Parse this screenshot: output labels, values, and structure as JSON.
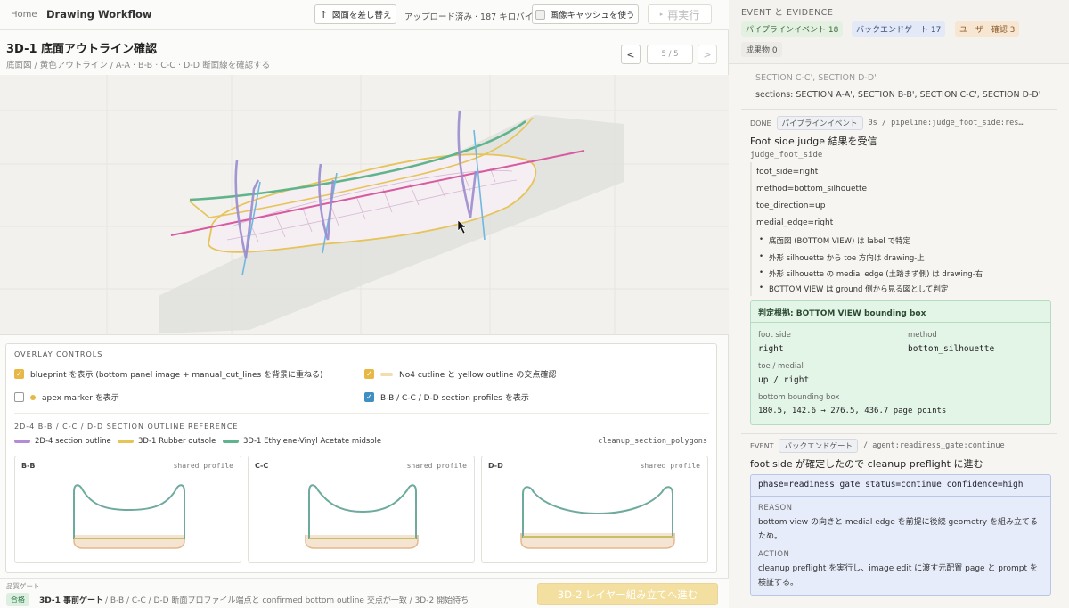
{
  "header": {
    "home": "Home",
    "title": "Drawing Workflow",
    "replace_btn": "図面を差し替え",
    "upload_status": "アップロード済み · 187 キロバイト",
    "cache_label": "画像キャッシュを使う",
    "rerun_btn": "再実行"
  },
  "step": {
    "title": "3D-1 底面アウトライン確認",
    "subtitle": "底面図 / 黄色アウトライン / A-A · B-B · C-C · D-D 断面線を確認する",
    "prev": "<",
    "next": ">",
    "page": "5 / 5"
  },
  "overlay": {
    "heading": "OVERLAY CONTROLS",
    "controls": [
      {
        "label": "blueprint を表示 (bottom panel image + manual_cut_lines を背景に重ねる)",
        "checked": true
      },
      {
        "label": "No4 cutline と yellow outline の交点確認",
        "checked": true
      },
      {
        "label": "apex marker を表示",
        "checked": false
      },
      {
        "label": "B-B / C-C / D-D section profiles を表示",
        "checked": true
      }
    ],
    "ref_heading": "2D-4 B-B / C-C / D-D SECTION OUTLINE REFERENCE",
    "legend": [
      {
        "label": "2D-4 section outline",
        "color": "#b58ad6"
      },
      {
        "label": "3D-1 Rubber outsole",
        "color": "#e6c458"
      },
      {
        "label": "3D-1 Ethylene-Vinyl Acetate midsole",
        "color": "#5fb48c"
      }
    ],
    "ref_source": "cleanup_section_polygons",
    "profiles": [
      {
        "name": "B-B",
        "note": "shared profile"
      },
      {
        "name": "C-C",
        "note": "shared profile"
      },
      {
        "name": "D-D",
        "note": "shared profile"
      }
    ]
  },
  "quality_gate": {
    "label": "品質ゲート",
    "badge": "合格",
    "title": "3D-1 事前ゲート",
    "detail": "/  B-B / C-C / D-D 断面プロファイル端点と confirmed bottom outline 交点が一致 / 3D-2 開始待ち",
    "advance_btn": "3D-2 レイヤー組み立てへ進む"
  },
  "evidence": {
    "heading": "EVENT と EVIDENCE",
    "chips": [
      {
        "label": "パイプラインイベント 18",
        "color": "#e4f1e2",
        "text": "#3f6a3b"
      },
      {
        "label": "バックエンドゲート 17",
        "color": "#e3e9f6",
        "text": "#3b4e7a"
      },
      {
        "label": "ユーザー確認 3",
        "color": "#f7e6d2",
        "text": "#8a5a2a"
      },
      {
        "label": "成果物 0",
        "color": "#ecebe7",
        "text": "#555"
      }
    ],
    "cut_line": "SECTION C-C', SECTION D-D'",
    "sections_line": "sections: SECTION A-A', SECTION B-B', SECTION C-C', SECTION D-D'",
    "ev1": {
      "status": "DONE",
      "chip": "パイプラインイベント",
      "meta": "0s  /  pipeline:judge_foot_side:res…",
      "title": "Foot side judge 結果を受信",
      "code": "judge_foot_side",
      "kv": [
        "foot_side=right",
        "method=bottom_silhouette",
        "toe_direction=up",
        "medial_edge=right"
      ],
      "bullets": [
        "底面図 (BOTTOM VIEW) は label で特定",
        "外形 silhouette から toe 方向は drawing-上",
        "外形 silhouette の medial edge (土踏まず側) は drawing-右",
        "BOTTOM VIEW は ground 側から見る図として判定"
      ],
      "box_title": "判定根拠: BOTTOM VIEW bounding box",
      "box": {
        "foot_side_label": "foot side",
        "foot_side": "right",
        "method_label": "method",
        "method": "bottom_silhouette",
        "toe_label": "toe / medial",
        "toe": "up / right",
        "bbox_label": "bottom bounding box",
        "bbox": "180.5, 142.6 → 276.5, 436.7 page points"
      }
    },
    "ev2": {
      "status": "EVENT",
      "chip": "バックエンドゲート",
      "meta": "/  agent:readiness_gate:continue",
      "title": "foot side が確定したので cleanup preflight に進む",
      "box_head": "phase=readiness_gate status=continue confidence=high",
      "reason_label": "REASON",
      "reason": "bottom view の向きと medial edge を前提に後続 geometry を組み立てるため。",
      "action_label": "ACTION",
      "action": "cleanup preflight を実行し、image edit に渡す元配置 page と prompt を検証する。"
    }
  }
}
